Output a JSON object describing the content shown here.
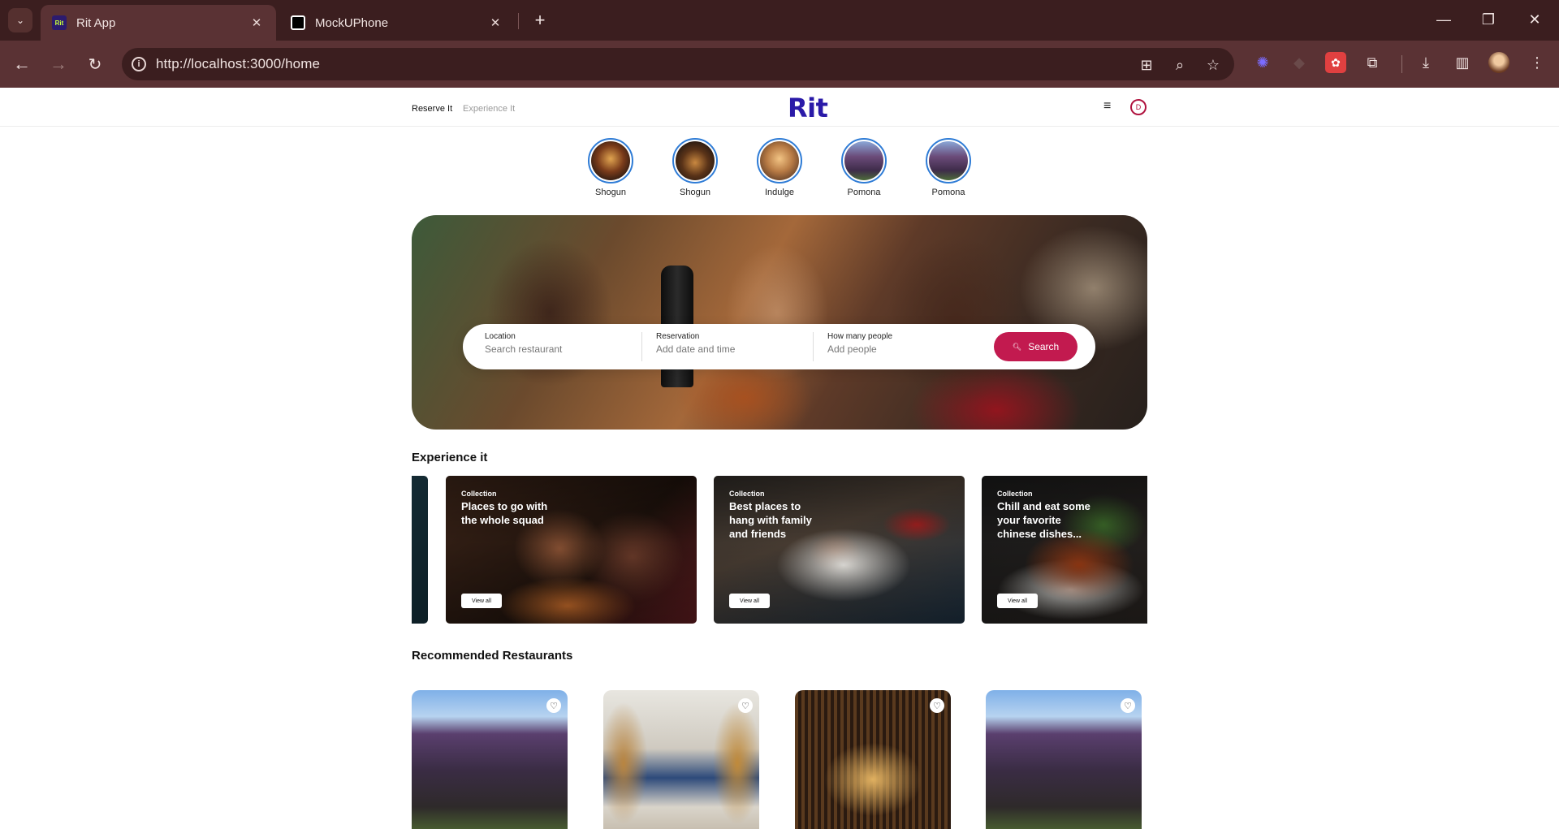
{
  "browser": {
    "tabs": [
      {
        "title": "Rit App",
        "favicon": "Rit",
        "active": true
      },
      {
        "title": "MockUPhone",
        "favicon": "mockuphone-icon",
        "active": false
      }
    ],
    "url": "http://localhost:3000/home",
    "icons": {
      "tab_list": "⌄",
      "close": "✕",
      "new_tab": "+",
      "minimize": "—",
      "restore": "❐",
      "window_close": "✕",
      "back": "←",
      "forward": "→",
      "reload": "↻",
      "info": "i",
      "install": "⊞",
      "zoom": "⌕",
      "star": "☆",
      "download": "⤓",
      "side_panel": "▥",
      "more": "⋮",
      "extensions": "⧉"
    }
  },
  "site": {
    "logo": "Rit",
    "nav": {
      "reserve": "Reserve It",
      "experience": "Experience It"
    },
    "menu_icon": "≡",
    "avatar_initial": "D"
  },
  "stories": [
    {
      "label": "Shogun"
    },
    {
      "label": "Shogun"
    },
    {
      "label": "Indulge"
    },
    {
      "label": "Pomona"
    },
    {
      "label": "Pomona"
    }
  ],
  "search": {
    "location_label": "Location",
    "location_placeholder": "Search restaurant",
    "reservation_label": "Reservation",
    "reservation_placeholder": "Add date and time",
    "people_label": "How many people",
    "people_placeholder": "Add people",
    "button_label": "Search"
  },
  "experience": {
    "title": "Experience it",
    "cards": [
      {
        "kicker": "Collection",
        "title": "Places to go with the whole squad",
        "button": "View all"
      },
      {
        "kicker": "Collection",
        "title": "Best places to hang with family and friends",
        "button": "View all"
      },
      {
        "kicker": "Collection",
        "title": "Chill and eat some your favorite chinese dishes...",
        "button": "View all"
      }
    ]
  },
  "recommended": {
    "title": "Recommended Restaurants",
    "fav_icon": "♡"
  },
  "colors": {
    "brand": "#2a1aa8",
    "accent": "#c21a4f",
    "chrome_dark": "#3b1e1f",
    "chrome_mid": "#5a3234"
  }
}
